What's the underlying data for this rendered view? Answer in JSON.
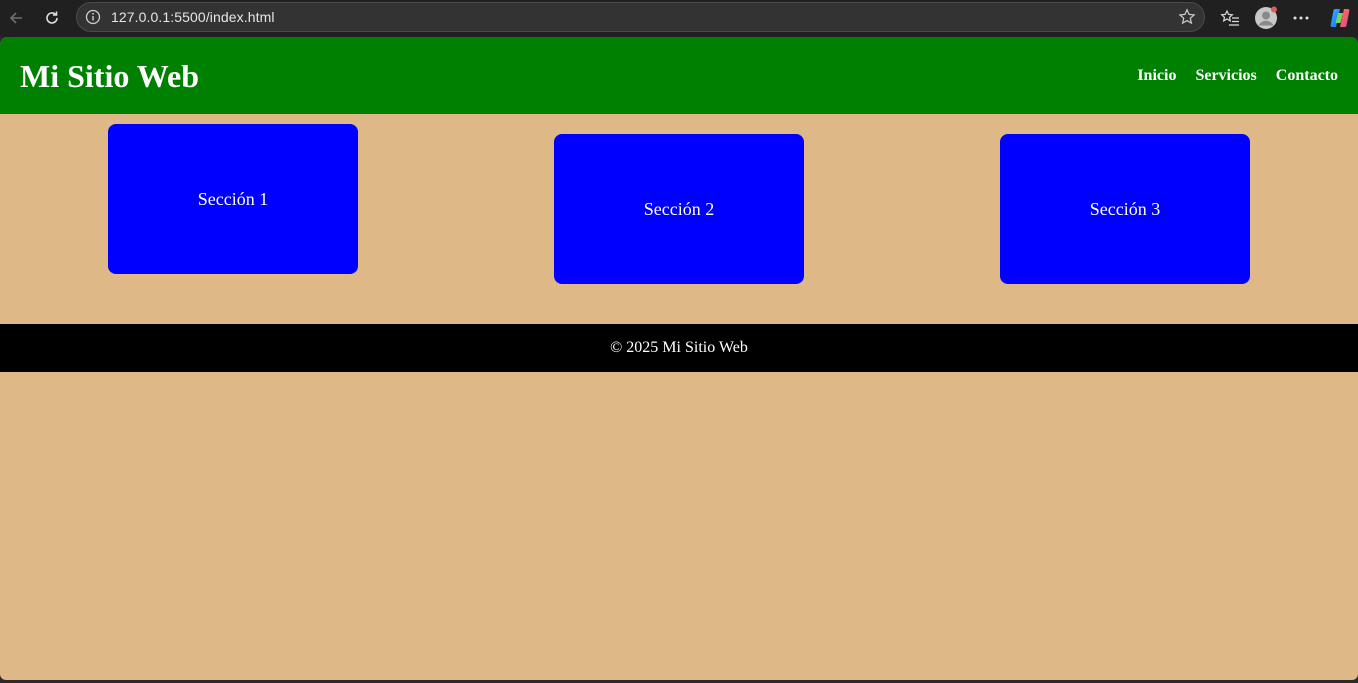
{
  "browser": {
    "url": "127.0.0.1:5500/index.html",
    "icons": [
      "back-arrow-icon",
      "refresh-icon",
      "info-icon",
      "star-icon",
      "favorites-icon",
      "profile-avatar-icon",
      "more-icon",
      "copilot-icon"
    ]
  },
  "header": {
    "title": "Mi Sitio Web",
    "nav": [
      "Inicio",
      "Servicios",
      "Contacto"
    ]
  },
  "sections": [
    "Sección 1",
    "Sección 2",
    "Sección 3"
  ],
  "footer": {
    "text": "© 2025 Mi Sitio Web"
  },
  "colors": {
    "header_bg": "#008000",
    "page_bg": "#deb887",
    "card_bg": "#0000ff",
    "footer_bg": "#000000"
  }
}
